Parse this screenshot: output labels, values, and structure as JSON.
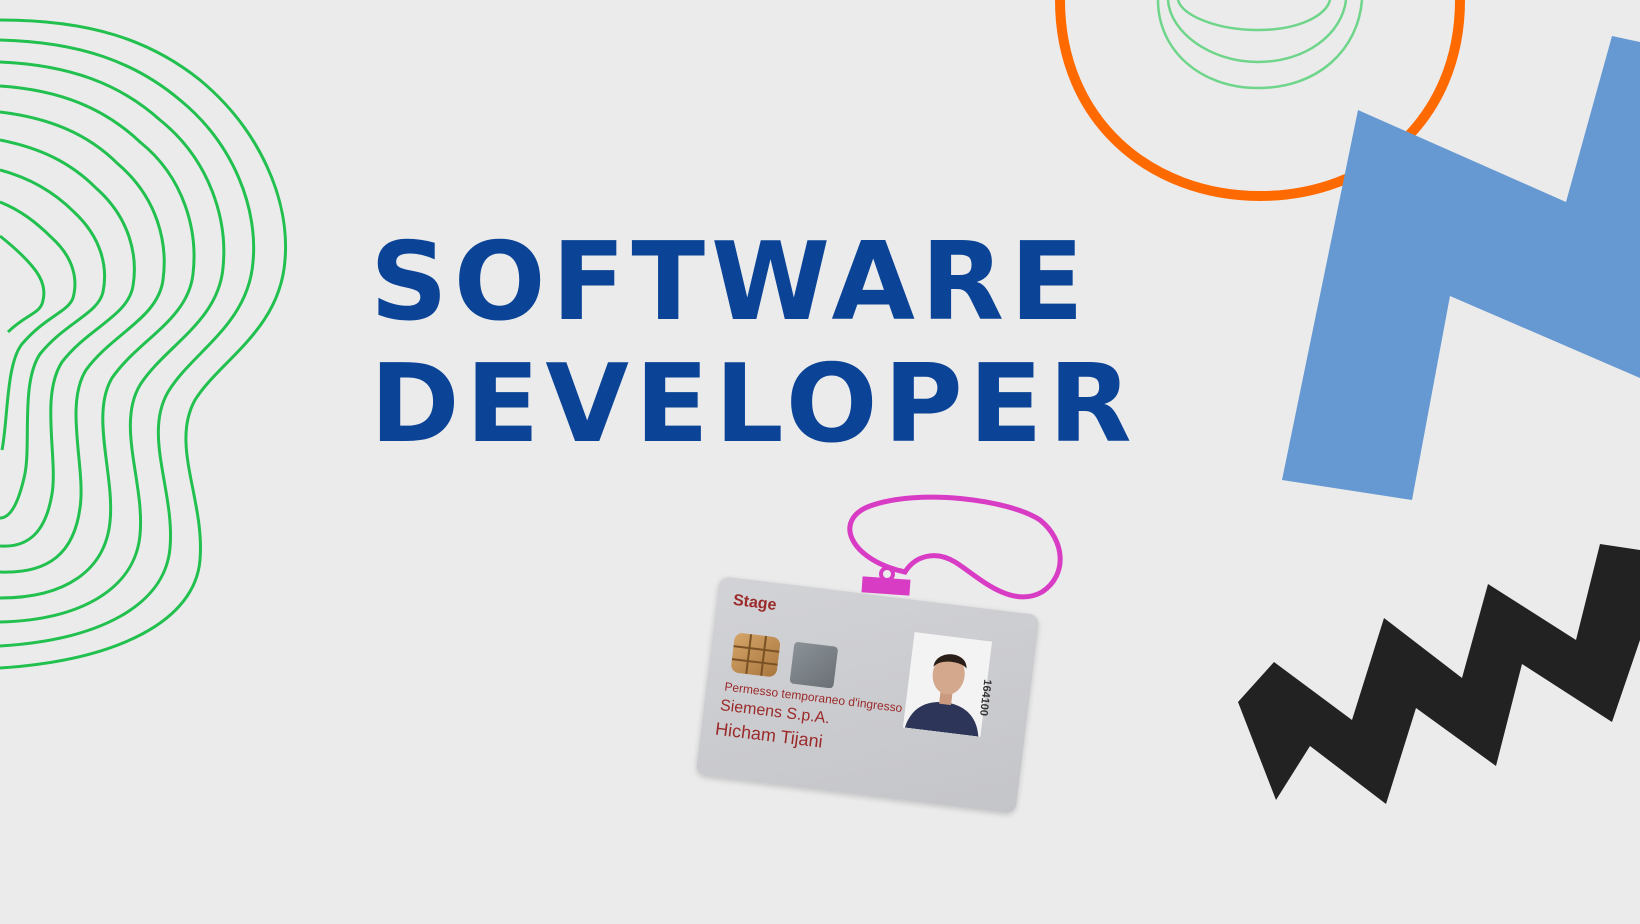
{
  "headline": {
    "line1": "SOFTWARE",
    "line2": "DEVELOPER"
  },
  "badge": {
    "stage_label": "Stage",
    "permit_text": "Permesso temporaneo d'ingresso",
    "company": "Siemens S.p.A.",
    "holder_name": "Hicham Tijani",
    "card_number": "164100"
  },
  "colors": {
    "background": "#ebebeb",
    "headline": "#0b4497",
    "contour_lines": "#22c04e",
    "circle_ring": "#ff6a00",
    "blue_shape": "#6699d1",
    "zigzag": "#222222",
    "lanyard": "#d93cc4",
    "badge_text": "#9b2a2a"
  },
  "decorations": [
    "green-contour-lines",
    "orange-circle-ring",
    "blue-n-shape",
    "black-zigzag",
    "lanyard"
  ]
}
